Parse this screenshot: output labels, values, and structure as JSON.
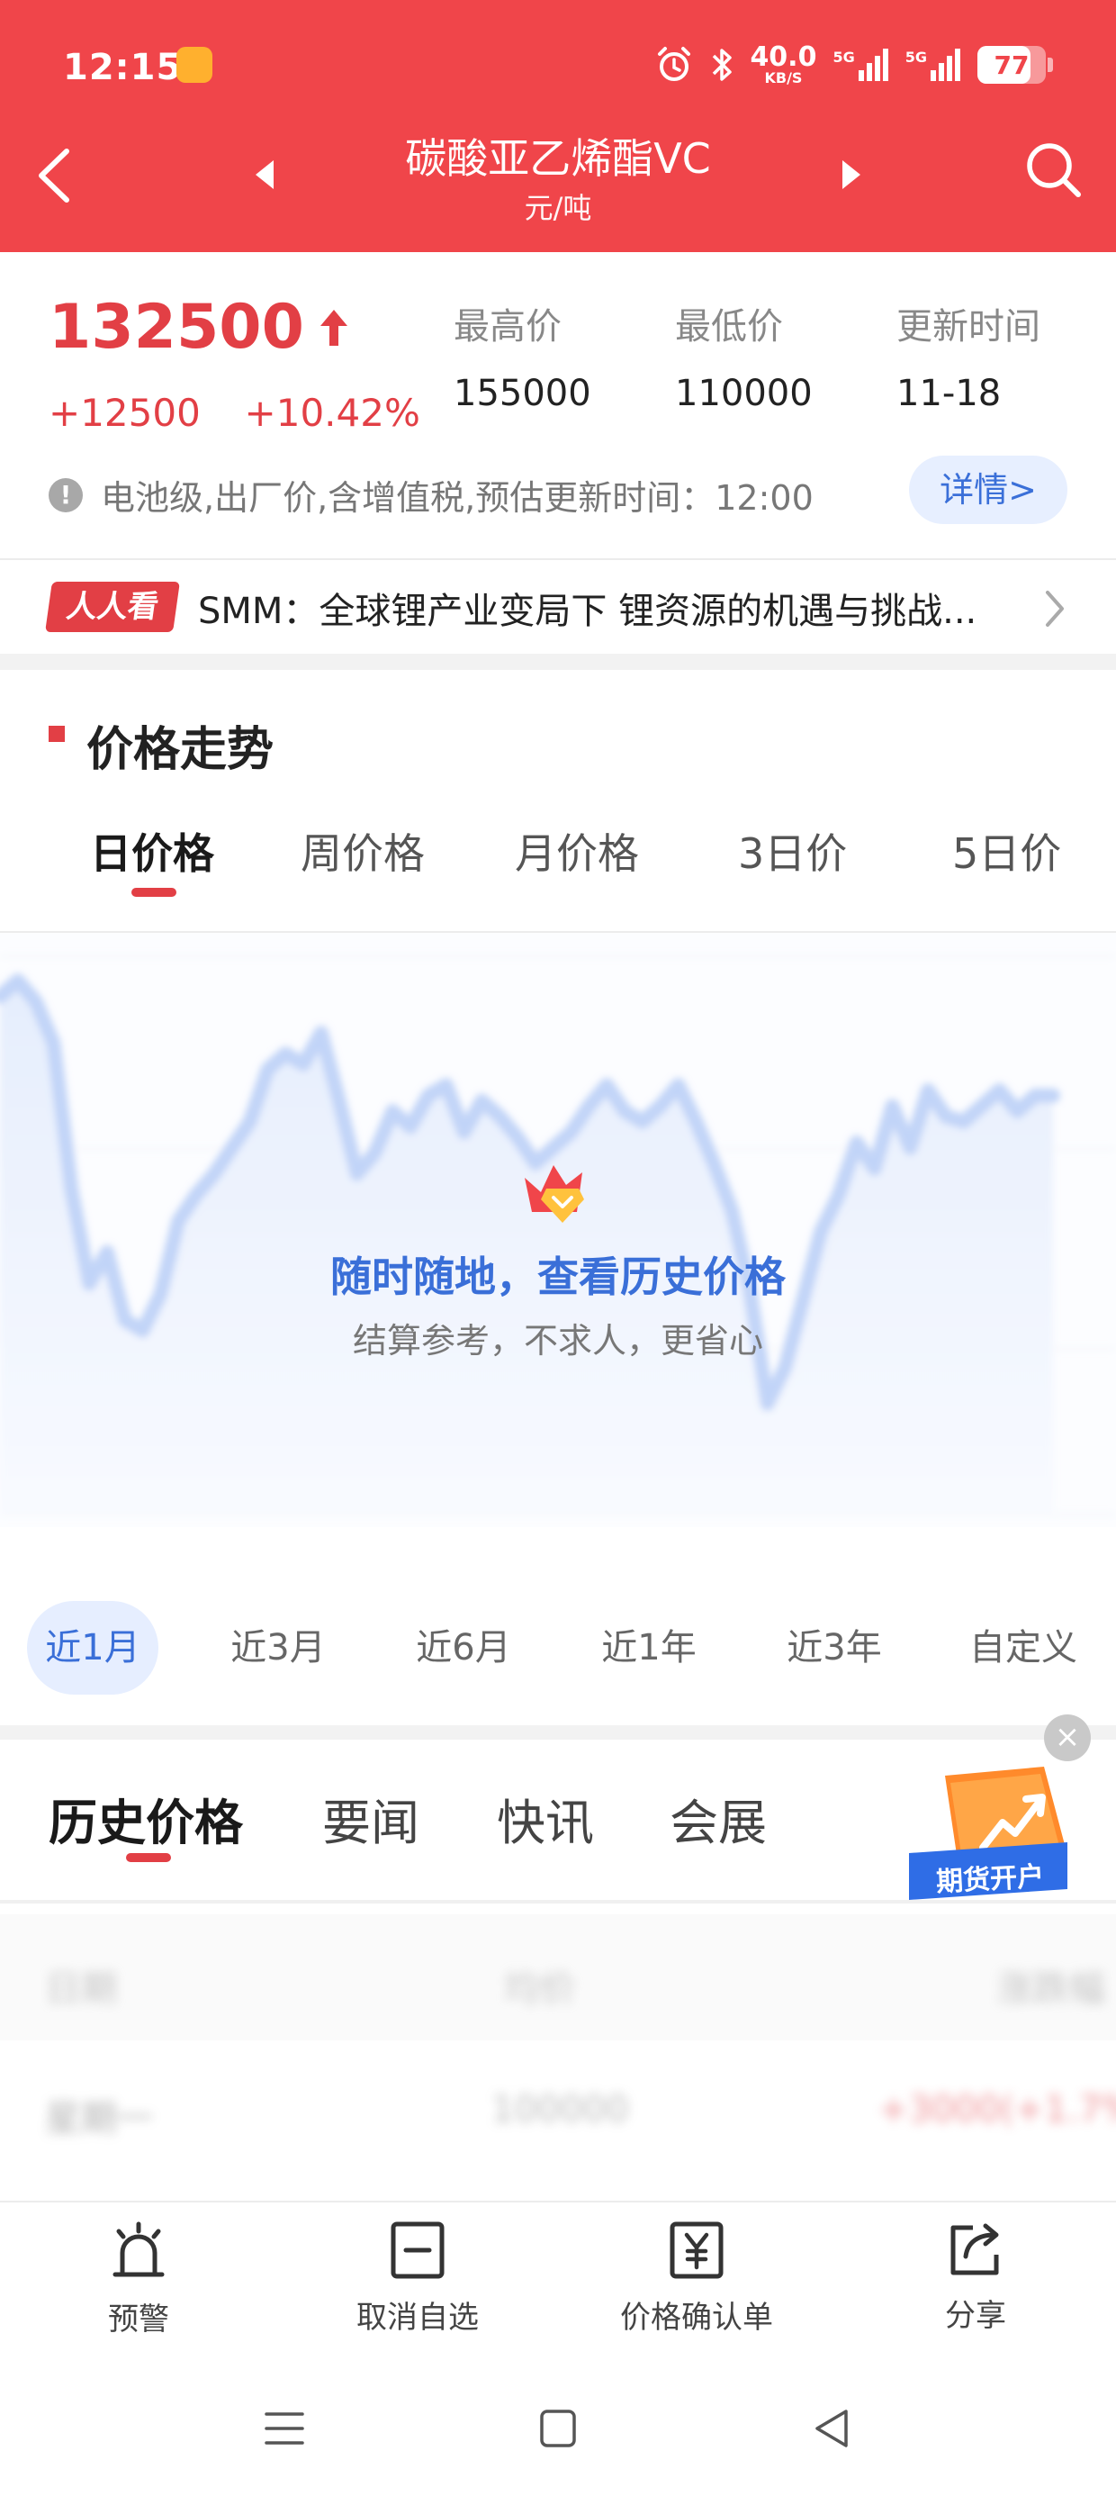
{
  "status_bar": {
    "time": "12:15",
    "net_speed_value": "40.0",
    "net_speed_unit": "KB/S",
    "sim1_label": "5G",
    "sim2_label": "5G",
    "battery_level": 77,
    "battery_text": "77"
  },
  "header": {
    "title": "碳酸亚乙烯酯VC",
    "subtitle": "元/吨",
    "icons": [
      "chevron-left-icon",
      "triangle-left-icon",
      "triangle-right-icon",
      "search-icon"
    ]
  },
  "price": {
    "current": "132500",
    "change_abs": "+12500",
    "change_pct": "+10.42%",
    "stats": [
      {
        "label": "最高价",
        "value": "155000"
      },
      {
        "label": "最低价",
        "value": "110000"
      },
      {
        "label": "更新时间",
        "value": "11-18"
      }
    ],
    "note": "电池级,出厂价,含增值税,预估更新时间：12:00",
    "detail_button": "详情>",
    "colors": {
      "up": "#e23f45",
      "header_bg": "#f0454a",
      "accent_blue": "#3a6fd8"
    }
  },
  "news": {
    "badge": "人人看",
    "headline": "SMM：全球锂产业变局下 锂资源的机遇与挑战..."
  },
  "trend": {
    "section_title": "价格走势",
    "tabs": [
      "日价格",
      "周价格",
      "月价格",
      "3日价",
      "5日价"
    ],
    "active_tab": 0,
    "overlay_title": "随时随地，查看历史价格",
    "overlay_subtitle": "结算参考，不求人，更省心",
    "ranges": [
      "近1月",
      "近3月",
      "近6月",
      "近1年",
      "近3年",
      "自定义"
    ],
    "active_range": 0
  },
  "chart_data": {
    "type": "area",
    "blurred": true,
    "values": [
      0.93,
      0.96,
      0.92,
      0.84,
      0.56,
      0.38,
      0.44,
      0.31,
      0.29,
      0.36,
      0.5,
      0.55,
      0.59,
      0.64,
      0.69,
      0.79,
      0.82,
      0.8,
      0.86,
      0.73,
      0.59,
      0.63,
      0.71,
      0.68,
      0.74,
      0.76,
      0.67,
      0.73,
      0.7,
      0.66,
      0.61,
      0.64,
      0.67,
      0.72,
      0.76,
      0.71,
      0.69,
      0.72,
      0.76,
      0.69,
      0.61,
      0.52,
      0.37,
      0.15,
      0.22,
      0.35,
      0.48,
      0.55,
      0.65,
      0.6,
      0.72,
      0.64,
      0.75,
      0.7,
      0.69,
      0.72,
      0.75,
      0.71,
      0.74,
      0.74
    ],
    "line_color": "#aac4f5",
    "fill_color": "#e4ecfd"
  },
  "history": {
    "tabs": [
      "历史价格",
      "要闻",
      "快讯",
      "会展"
    ],
    "active_tab": 0,
    "futures_badge": "期货开户",
    "close_symbol": "×"
  },
  "bottom_bar": {
    "items": [
      {
        "label": "预警",
        "icon": "alarm-bell-icon"
      },
      {
        "label": "取消自选",
        "icon": "minus-square-icon"
      },
      {
        "label": "价格确认单",
        "icon": "yuan-document-icon"
      },
      {
        "label": "分享",
        "icon": "share-icon"
      }
    ]
  },
  "system_nav": {
    "icons": [
      "menu-icon",
      "home-square-icon",
      "back-triangle-icon"
    ]
  }
}
